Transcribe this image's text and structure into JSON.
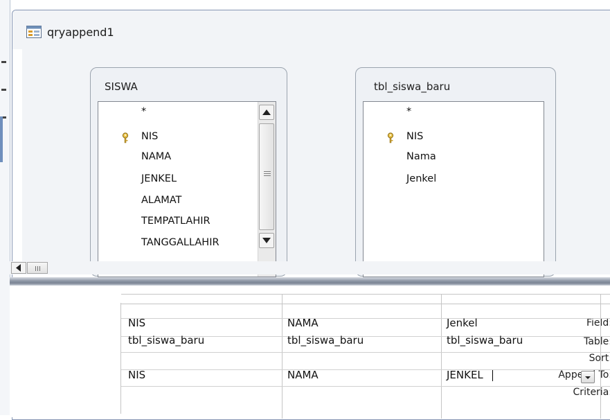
{
  "window": {
    "title": "qryappend1"
  },
  "tables": [
    {
      "name": "SISWA",
      "fields": [
        "*",
        "NIS",
        "NAMA",
        "JENKEL",
        "ALAMAT",
        "TEMPATLAHIR",
        "TANGGALLAHIR"
      ],
      "primary_key": "NIS",
      "has_scrollbar": true
    },
    {
      "name": "tbl_siswa_baru",
      "fields": [
        "*",
        "NIS",
        "Nama",
        "Jenkel"
      ],
      "primary_key": "NIS",
      "has_scrollbar": false
    }
  ],
  "design_grid": {
    "row_labels": [
      "Field:",
      "Table:",
      "Sort:",
      "Append To:",
      "Criteria:"
    ],
    "columns": [
      {
        "field": "NIS",
        "table": "tbl_siswa_baru",
        "sort": "",
        "append_to": "NIS",
        "criteria": ""
      },
      {
        "field": "NAMA",
        "table": "tbl_siswa_baru",
        "sort": "",
        "append_to": "NAMA",
        "criteria": ""
      },
      {
        "field": "Jenkel",
        "table": "tbl_siswa_baru",
        "sort": "",
        "append_to": "JENKEL",
        "criteria": ""
      }
    ]
  },
  "icons": {
    "query": "query-icon",
    "key": "key-icon",
    "scroll_up": "arrow-up-icon",
    "scroll_down": "arrow-down-icon",
    "scroll_left": "arrow-left-icon",
    "dropdown": "chevron-down-icon"
  },
  "colors": {
    "upper_pane_bg": "#f2f4f7",
    "splitter": "#8d96a5",
    "border": "#8595b3"
  }
}
